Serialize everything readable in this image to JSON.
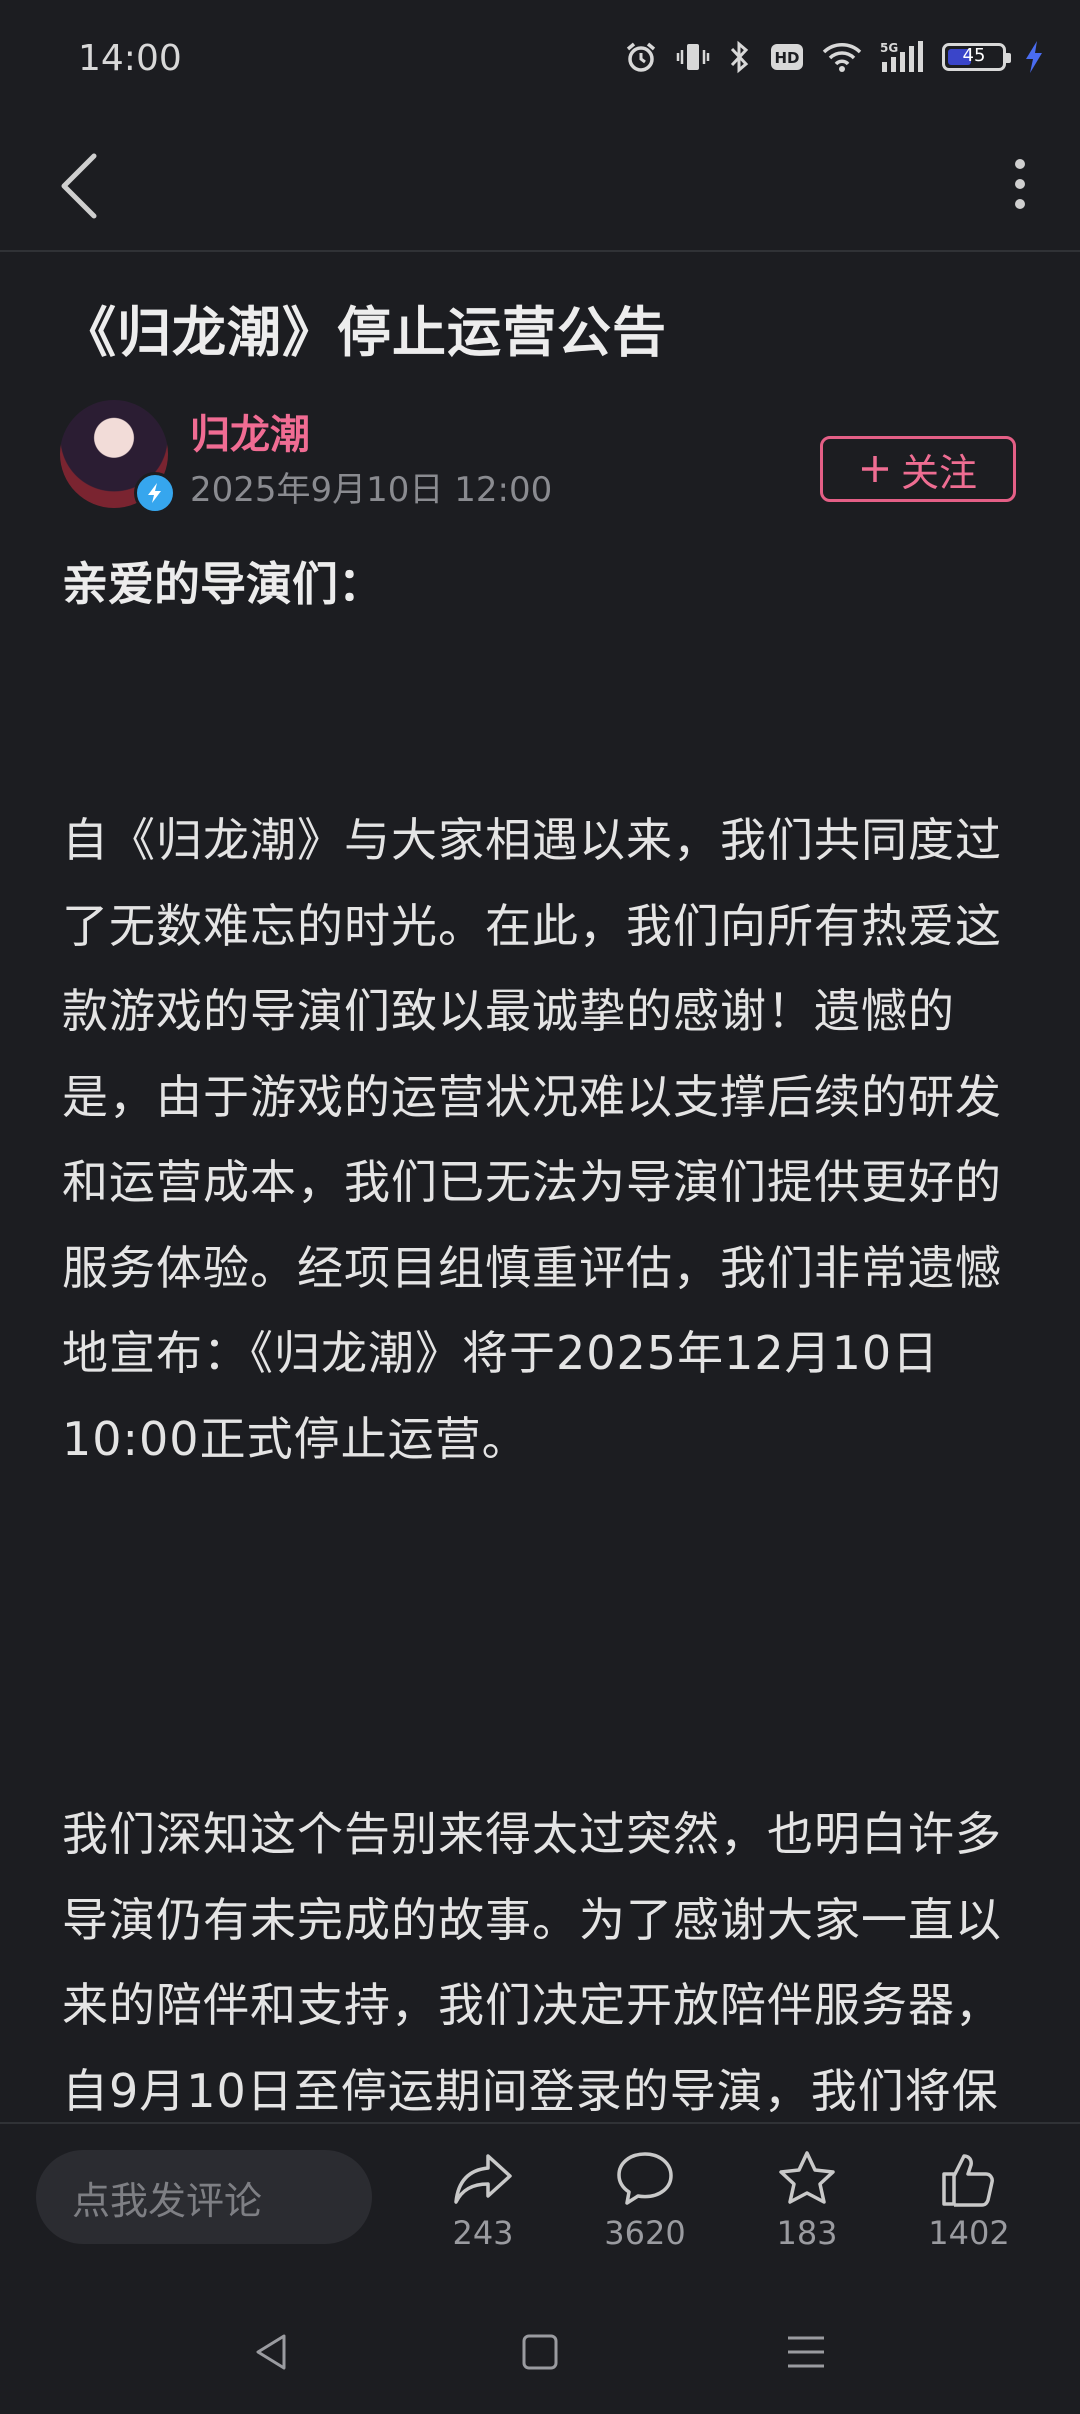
{
  "status_bar": {
    "time": "14:00",
    "battery": "45",
    "battery_level": 0.45,
    "icons": [
      "alarm-icon",
      "vibrate-icon",
      "bluetooth-icon",
      "hd-icon",
      "wifi-icon",
      "signal-5g-icon",
      "battery-icon",
      "charging-icon"
    ]
  },
  "app_bar": {
    "back_icon": "chevron-left-icon",
    "more_icon": "more-vertical-icon"
  },
  "article": {
    "title": "《归龙潮》停止运营公告",
    "author": "归龙潮",
    "date": "2025年9月10日 12:00",
    "follow_label": "关注",
    "greeting": "亲爱的导演们：",
    "paragraphs": [
      "自《归龙潮》与大家相遇以来，我们共同度过了无数难忘的时光。在此，我们向所有热爱这款游戏的导演们致以最诚挚的感谢！遗憾的是，由于游戏的运营状况难以支撑后续的研发和运营成本，我们已无法为导演们提供更好的服务体验。经项目组慎重评估，我们非常遗憾地宣布：《归龙潮》将于2025年12月10日10:00正式停止运营。",
      "我们深知这个告别来得太过突然，也明白许多导演仍有未完成的故事。为了感谢大家一直以来的陪伴和支持，我们决定开放陪伴服务器，自9月10日至停运期间登录的导演，我们将保留其账号数据，保留的账"
    ]
  },
  "bottom_bar": {
    "comment_placeholder": "点我发评论",
    "share_count": "243",
    "comment_count": "3620",
    "favorite_count": "183",
    "like_count": "1402"
  },
  "colors": {
    "background": "#1c1d21",
    "accent": "#ee6d92",
    "verified_badge": "#36a6ee"
  }
}
